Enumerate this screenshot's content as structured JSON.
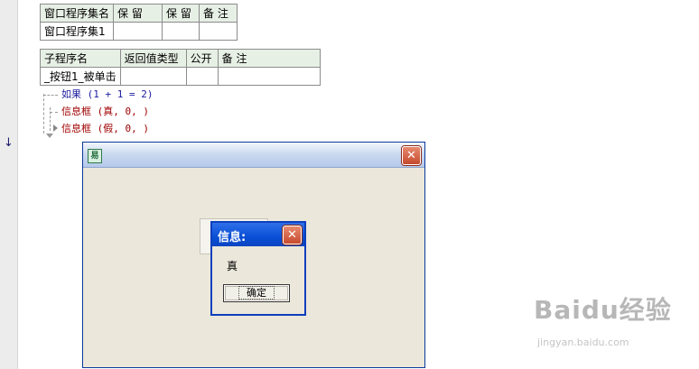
{
  "table1": {
    "headers": [
      "窗口程序集名",
      "保 留",
      "保 留",
      "备 注"
    ],
    "row": [
      "窗口程序集1",
      "",
      "",
      ""
    ]
  },
  "table2": {
    "headers": [
      "子程序名",
      "返回值类型",
      "公开",
      "备 注"
    ],
    "row": [
      "_按钮1_被单击",
      "",
      "",
      ""
    ]
  },
  "code": {
    "line1": "如果 (1 + 1 = 2)",
    "line2": "信息框 (真, 0, )",
    "line3": "信息框 (假, 0, )"
  },
  "gutter": {
    "arrow": "↓"
  },
  "main_window": {
    "close": "✕",
    "icon": "易"
  },
  "msgbox": {
    "title": "信息:",
    "text": "真",
    "ok_label": "确定",
    "close": "✕"
  },
  "watermark": {
    "brand": "Baidu经验",
    "url": "jingyan.baidu.com"
  },
  "colors": {
    "titlebar_blue": "#0a4fd6",
    "keyword_blue": "#1c1ca0",
    "keyword_red": "#a00000",
    "header_bg": "#e7f0e5"
  }
}
